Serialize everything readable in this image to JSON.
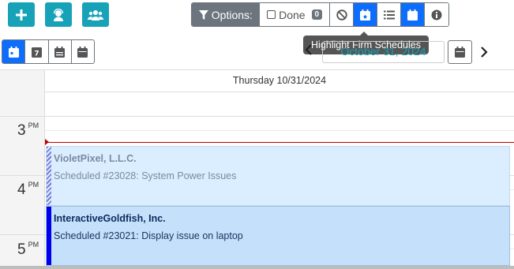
{
  "toolbar": {
    "add_icon": "plus-icon",
    "user_icon": "user-headset-icon",
    "group_icon": "users-icon",
    "options_label": "Options:",
    "done_label": "Done",
    "done_count": "0",
    "option_icons": [
      "ban-icon",
      "calendar-star-icon",
      "list-icon",
      "calendar-icon",
      "info-icon"
    ],
    "active_option_icons": [
      "calendar-star-icon",
      "calendar-icon"
    ]
  },
  "tooltip": {
    "text": "Highlight Firm Schedules"
  },
  "view_buttons": [
    {
      "icon": "calendar-day-icon",
      "active": true
    },
    {
      "icon": "calendar-week-icon",
      "label": "7",
      "active": false
    },
    {
      "icon": "calendar-month-icon",
      "active": false
    },
    {
      "icon": "calendar-icon",
      "active": false
    }
  ],
  "date_nav": {
    "current_date": "October 31, 2024",
    "prev_icon": "chevron-left-icon",
    "next_icon": "chevron-right-icon",
    "picker_icon": "calendar-icon"
  },
  "calendar": {
    "day_header": "Thursday 10/31/2024",
    "hours": [
      {
        "hour": "3",
        "ampm": "PM"
      },
      {
        "hour": "4",
        "ampm": "PM"
      },
      {
        "hour": "5",
        "ampm": "PM"
      }
    ],
    "events": [
      {
        "title": "VioletPixel, L.L.C.",
        "subtitle": "Scheduled #23028: System Power Issues",
        "style": "faded"
      },
      {
        "title": "InteractiveGoldfish, Inc.",
        "subtitle": "Scheduled #23021: Display issue on laptop",
        "style": "active"
      }
    ]
  },
  "colors": {
    "teal": "#17a2b8",
    "primary": "#0d6efd",
    "gray": "#6c757d",
    "now_line": "#c00000"
  }
}
